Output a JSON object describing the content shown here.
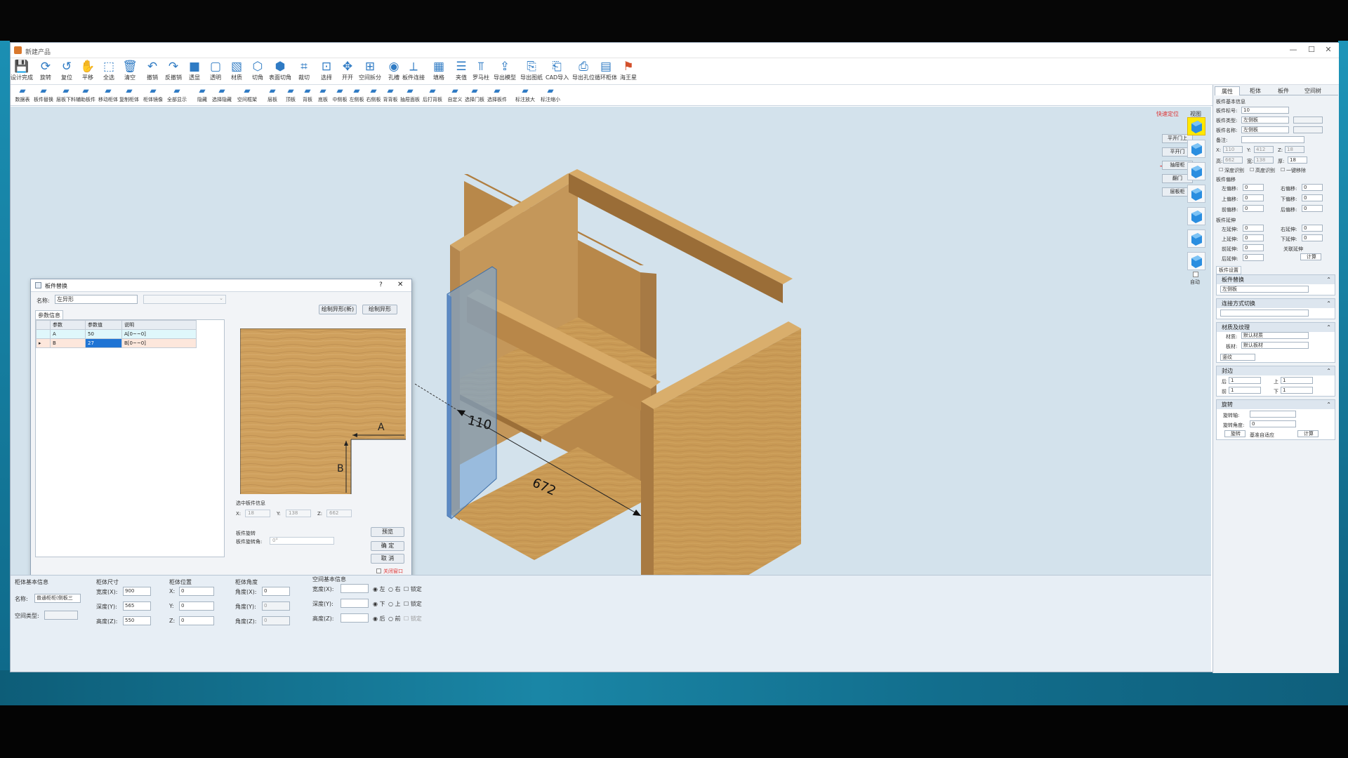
{
  "app": {
    "title": "新建产品",
    "window_controls": [
      "—",
      "☐",
      "✕"
    ]
  },
  "toolbar_main": [
    {
      "label": "设计完成",
      "icon": "save-icon"
    },
    {
      "label": "旋转",
      "icon": "rotate-icon"
    },
    {
      "label": "复位",
      "icon": "reset-icon"
    },
    {
      "label": "平移",
      "icon": "hand-icon"
    },
    {
      "label": "全选",
      "icon": "select-all-icon"
    },
    {
      "label": "清空",
      "icon": "trash-icon"
    },
    {
      "label": "撤销",
      "icon": "undo-icon"
    },
    {
      "label": "反撤销",
      "icon": "redo-icon"
    },
    {
      "label": "透显",
      "icon": "transparent-icon"
    },
    {
      "label": "透明",
      "icon": "transparency-icon"
    },
    {
      "label": "材质",
      "icon": "material-icon"
    },
    {
      "label": "切角",
      "icon": "chamfer-icon"
    },
    {
      "label": "表面切角",
      "icon": "surface-chamfer-icon"
    },
    {
      "label": "裁切",
      "icon": "cut-icon"
    },
    {
      "label": "选择",
      "icon": "select-icon"
    },
    {
      "label": "开开",
      "icon": "open-icon"
    },
    {
      "label": "空间拆分",
      "icon": "split-space-icon"
    },
    {
      "label": "孔槽",
      "icon": "hole-icon"
    },
    {
      "label": "板件连接",
      "icon": "connect-icon"
    },
    {
      "label": "填格",
      "icon": "grid-fill-icon"
    },
    {
      "label": "夹值",
      "icon": "clamp-icon"
    },
    {
      "label": "罗马柱",
      "icon": "pillar-icon"
    },
    {
      "label": "导出模型",
      "icon": "export-model-icon"
    },
    {
      "label": "导出图纸",
      "icon": "cad-export-icon"
    },
    {
      "label": "CAD导入",
      "icon": "cad-import-icon"
    },
    {
      "label": "导出孔位",
      "icon": "pdf-export-icon"
    },
    {
      "label": "循环柜体",
      "icon": "cabinet-loop-icon"
    },
    {
      "label": "海王星",
      "icon": "neptune-icon"
    }
  ],
  "toolbar_secondary": [
    "数据表",
    "板件替换",
    "层板下料",
    "辅助板件",
    "移动柜体",
    "复制柜体",
    "柜体镜像",
    "全部显示",
    "隐藏",
    "选择隐藏",
    "空间框架",
    "层板",
    "顶板",
    "背板",
    "底板",
    "中侧板",
    "左侧板",
    "右侧板",
    "背背板",
    "抽屉面板",
    "后打背板",
    "自定义",
    "选择门板",
    "选择板件",
    "标注放大",
    "标注缩小"
  ],
  "viewport": {
    "dimension_small": "110",
    "dimension_large": "672"
  },
  "side_buttons": {
    "quick_locate": "快速定位",
    "view_label": "视图",
    "buttons": [
      "平开门上",
      "平开门",
      "抽屉柜",
      "翻门",
      "层板柜"
    ],
    "auto_label": "自动"
  },
  "dialog": {
    "title": "板件替换",
    "help": "?",
    "close": "✕",
    "name_label": "名称:",
    "name_value": "左异形",
    "params_tab": "参数信息",
    "columns": [
      "参数",
      "参数值",
      "说明"
    ],
    "rows": [
      {
        "param": "A",
        "value": "50",
        "desc": "A[0~~0]"
      },
      {
        "param": "B",
        "value": "27",
        "desc": "B[0~~0]"
      }
    ],
    "btn_draw_new": "绘制异形(新)",
    "btn_draw": "绘制异形",
    "dim_a": "A",
    "dim_b": "B",
    "selected_info": "选中板件信息",
    "x_label": "X:",
    "x_value": "18",
    "y_label": "Y:",
    "y_value": "138",
    "z_label": "Z:",
    "z_value": "662",
    "rotate_title": "板件旋转",
    "rotate_label": "板件旋转角:",
    "rotate_value": "0°",
    "btn_preview": "预览",
    "btn_ok": "确 定",
    "btn_cancel": "取 消",
    "close_window": "关闭窗口"
  },
  "bottom": {
    "basic": {
      "title": "柜体基本信息",
      "name_label": "名称:",
      "name_value": "普通柜柜(侧板三",
      "type_label": "空间类型:"
    },
    "size": {
      "title": "柜体尺寸",
      "w_label": "宽度(X):",
      "w": "900",
      "d_label": "深度(Y):",
      "d": "565",
      "h_label": "高度(Z):",
      "h": "550"
    },
    "pos": {
      "title": "柜体位置",
      "x_label": "X:",
      "x": "0",
      "y_label": "Y:",
      "y": "0",
      "z_label": "Z:",
      "z": "0"
    },
    "angle": {
      "title": "柜体角度",
      "a1_label": "角度(X):",
      "a1": "0",
      "a2_label": "角度(Y):",
      "a2": "0",
      "a3_label": "角度(Z):",
      "a3": "0"
    },
    "space": {
      "title": "空间基本信息",
      "rows": [
        {
          "label": "宽度(X):",
          "opt1": "左",
          "opt2": "右",
          "lock": "锁定"
        },
        {
          "label": "深度(Y):",
          "opt1": "下",
          "opt2": "上",
          "lock": "锁定"
        },
        {
          "label": "高度(Z):",
          "opt1": "后",
          "opt2": "前",
          "lock": "锁定"
        }
      ]
    }
  },
  "right_panel": {
    "tabs": [
      "属性",
      "柜体",
      "板件",
      "空间树"
    ],
    "section_basic": "板件基本信息",
    "fields": [
      {
        "label": "板件标号:",
        "value": "10"
      },
      {
        "label": "板件类型:",
        "value": "左侧板"
      },
      {
        "label": "板件名称:",
        "value": "左侧板"
      },
      {
        "label": "备注:",
        "value": ""
      }
    ],
    "xyz": {
      "x_label": "X:",
      "x": "110",
      "y_label": "Y:",
      "y": "412",
      "z_label": "Z:",
      "z": "18"
    },
    "size": {
      "l_label": "高:",
      "l": "662",
      "w_label": "宽:",
      "w": "138",
      "t_label": "厚:",
      "t": "18"
    },
    "checks": [
      "深度识别",
      "高度识别",
      "一键移除"
    ],
    "offset_title": "板件偏移",
    "offsets": [
      {
        "label": "左偏移:",
        "value": "0"
      },
      {
        "label": "右偏移:",
        "value": "0"
      },
      {
        "label": "上偏移:",
        "value": "0"
      },
      {
        "label": "下偏移:",
        "value": "0"
      },
      {
        "label": "前偏移:",
        "value": "0"
      },
      {
        "label": "后偏移:",
        "value": "0"
      }
    ],
    "extend_title": "板件延伸",
    "extends": [
      {
        "label": "左延伸:",
        "value": "0"
      },
      {
        "label": "右延伸:",
        "value": "0"
      },
      {
        "label": "上延伸:",
        "value": "0"
      },
      {
        "label": "下延伸:",
        "value": "0"
      },
      {
        "label": "前延伸:",
        "value": "0"
      },
      {
        "label": "后延伸:",
        "value": "0"
      }
    ],
    "extend_check": "关联延伸",
    "calc_button": "计算",
    "settings_tab": "板件设置",
    "sec_replace": "板件替换",
    "replace_value": "左侧板",
    "sec_connect": "连接方式切换",
    "sec_material": "材质及纹理",
    "material_label": "材质:",
    "material_value": "默认材质",
    "board_label": "板材:",
    "board_value": "默认板材",
    "grain_value": "竖纹",
    "sec_edge": "封边",
    "edge": [
      {
        "label": "后",
        "value": "1"
      },
      {
        "label": "上",
        "value": "1"
      },
      {
        "label": "前",
        "value": "1"
      },
      {
        "label": "下",
        "value": "1"
      }
    ],
    "sec_rotate": "旋转",
    "rotate_axis_label": "旋转轴:",
    "rotate_angle_label": "旋转角度:",
    "rotate_angle_value": "0",
    "rotate_btn": "旋转",
    "auto_align_label": "基准自适应",
    "calc_btn2": "计算"
  },
  "colors": {
    "accent": "#2f7bc4",
    "selected_view": "#ffe900",
    "wood": "#c99a55"
  }
}
